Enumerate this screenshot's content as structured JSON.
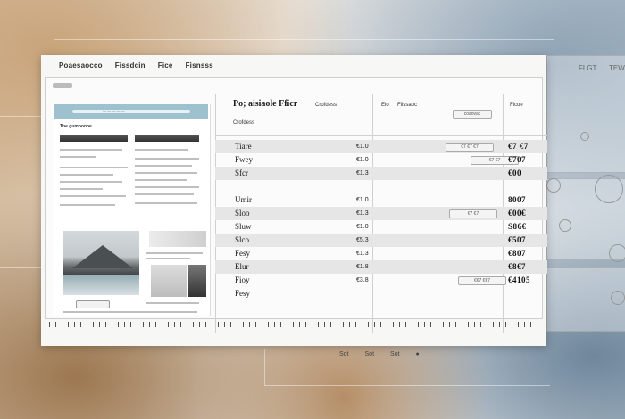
{
  "menu": {
    "items": [
      "Poaesaocco",
      "Fissdcin",
      "Fice",
      "Fisnsss"
    ]
  },
  "header": {
    "title": "Po; aisiaole  Fficr",
    "col2": "Crofdess",
    "col3": "Eio",
    "col3b": "Fiissaoc",
    "chip": "coaovac",
    "col4": "Flcoe"
  },
  "preview": {
    "banner_text": "— — — — —",
    "section_title": "Tbe gumoonoe",
    "button_label": ""
  },
  "rows": [
    {
      "label": "Tiare",
      "value": "€1.0",
      "total": "€7 €7",
      "chip": "€7 €7 €7",
      "shade": true
    },
    {
      "label": "Fwey",
      "value": "€1.0",
      "total": "€707",
      "chip": "€7 €7",
      "shade": false
    },
    {
      "label": "Sfcr",
      "value": "€1.3",
      "total": "€00",
      "chip": "",
      "shade": true
    },
    {
      "label": "",
      "value": "",
      "total": "",
      "chip": "",
      "shade": false
    },
    {
      "label": "Umir",
      "value": "€1.0",
      "total": "8007",
      "chip": "",
      "shade": false
    },
    {
      "label": "Sloo",
      "value": "€1.3",
      "total": "€00€",
      "chip": "€7 €7",
      "shade": true
    },
    {
      "label": "Sluw",
      "value": "€1.0",
      "total": "S86€",
      "chip": "",
      "shade": false
    },
    {
      "label": "Slco",
      "value": "€5.3",
      "total": "€507",
      "chip": "",
      "shade": true
    },
    {
      "label": "Fesy",
      "value": "€1.3",
      "total": "€807",
      "chip": "",
      "shade": false
    },
    {
      "label": "Elur",
      "value": "€1.8",
      "total": "€8€7",
      "chip": "",
      "shade": true
    },
    {
      "label": "Fioy",
      "value": "€3.8",
      "total": "€4105",
      "chip": "€€7 €€7",
      "shade": false
    },
    {
      "label": "Fesy",
      "value": "",
      "total": "",
      "chip": "",
      "shade": false
    }
  ],
  "side": {
    "label1": "FLGT",
    "label2": "TEW"
  },
  "status": {
    "item1": "Sot",
    "item2": "Sot",
    "item3": "Sot"
  }
}
